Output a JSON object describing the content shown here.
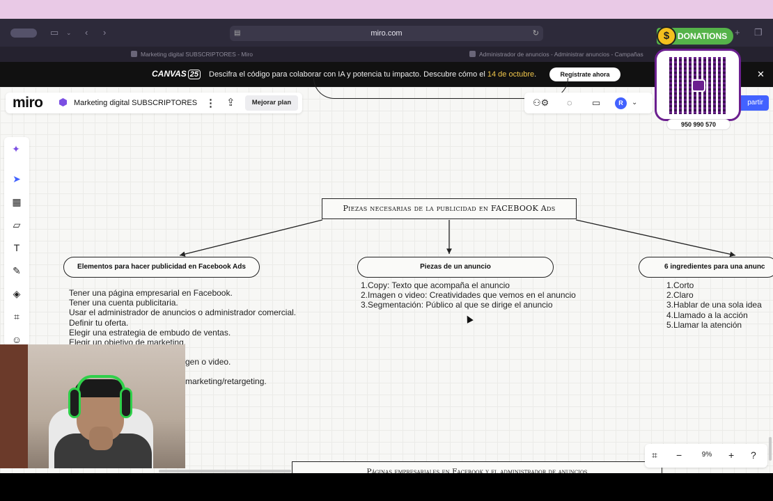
{
  "browser": {
    "url": "miro.com",
    "tabs": [
      {
        "title": "Marketing digital SUBSCRIPTORES - Miro"
      },
      {
        "title": "Administrador de anuncios - Administrar anuncios - Campañas"
      }
    ]
  },
  "banner": {
    "logo": "CANVAS",
    "logo_num": "25",
    "text": "Descifra el código para colaborar con IA y potencia tu impacto. Descubre cómo el ",
    "highlight": "14 de octubre",
    "text_end": ".",
    "cta": "Regístrate ahora"
  },
  "donation": {
    "label": "DONATIONS",
    "coin": "$",
    "phone": "950 990 570"
  },
  "miro": {
    "logo": "miro",
    "board_name": "Marketing digital SUBSCRIPTORES",
    "upgrade_label": "Mejorar plan",
    "avatar_initial": "R",
    "share_label": "partir",
    "zoom": "9%"
  },
  "board": {
    "title": "Piezas necesarias de la publicidad en FACEBOOK Ads",
    "branches": [
      {
        "label": "Elementos para hacer publicidad en Facebook Ads",
        "items": [
          "Tener una página empresarial en Facebook.",
          "Tener una cuenta publicitaria.",
          "Usar el administrador de anuncios o administrador comercial.",
          "Definir tu oferta.",
          "Elegir una estrategia de embudo de ventas.",
          "Elegir un objetivo de marketing."
        ],
        "partial_items": [
          "gen o video.",
          "marketing/retargeting."
        ]
      },
      {
        "label": "Piezas de un anuncio",
        "items": [
          "1.Copy: Texto que acompaña el anuncio",
          "2.Imagen o video: Creatividades que vemos en el anuncio",
          "3.Segmentación: Público al que se dirige el anuncio"
        ]
      },
      {
        "label": "6 ingredientes para una anunc",
        "items": [
          "1.Corto",
          "2.Claro",
          "3.Hablar de una sola idea",
          "4.Llamado a la acción",
          "5.Llamar la atención"
        ]
      }
    ],
    "bottom_node": "Páginas empresariales en Facebook y el administrador de anuncios"
  }
}
